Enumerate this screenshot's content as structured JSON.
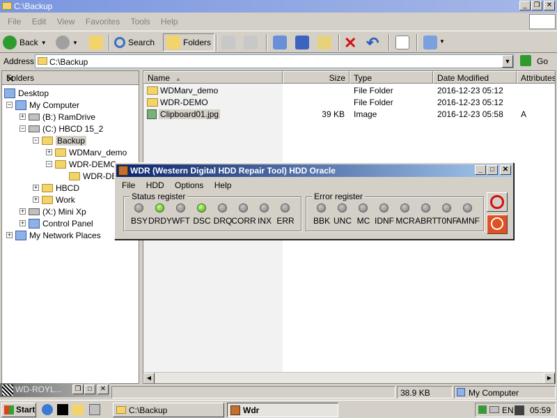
{
  "window": {
    "title": "C:\\Backup"
  },
  "menu": [
    "File",
    "Edit",
    "View",
    "Favorites",
    "Tools",
    "Help"
  ],
  "toolbar": {
    "back": "Back",
    "search": "Search",
    "folders": "Folders"
  },
  "address": {
    "label": "Address",
    "value": "C:\\Backup",
    "go": "Go"
  },
  "folders_pane": {
    "title": "Folders",
    "tree": [
      {
        "label": "Desktop"
      },
      {
        "label": "My Computer"
      },
      {
        "label": "(B:) RamDrive"
      },
      {
        "label": "(C:) HBCD 15_2"
      },
      {
        "label": "Backup"
      },
      {
        "label": "WDMarv_demo"
      },
      {
        "label": "WDR-DEMO"
      },
      {
        "label": "WDR-DE"
      },
      {
        "label": "HBCD"
      },
      {
        "label": "Work"
      },
      {
        "label": "(X:) Mini Xp"
      },
      {
        "label": "Control Panel"
      },
      {
        "label": "My Network Places"
      }
    ]
  },
  "list": {
    "columns": [
      "Name",
      "Size",
      "Type",
      "Date Modified",
      "Attributes"
    ],
    "rows": [
      {
        "name": "WDMarv_demo",
        "size": "",
        "type": "File Folder",
        "date": "2016-12-23 05:12",
        "attr": ""
      },
      {
        "name": "WDR-DEMO",
        "size": "",
        "type": "File Folder",
        "date": "2016-12-23 05:12",
        "attr": ""
      },
      {
        "name": "Clipboard01.jpg",
        "size": "39 KB",
        "type": "Image",
        "date": "2016-12-23 05:58",
        "attr": "A"
      }
    ]
  },
  "statusbar": {
    "size": "38.9 KB",
    "location": "My Computer"
  },
  "mini_window": {
    "title": "WD-ROYL..."
  },
  "wdr": {
    "title": "WDR (Western Digital HDD Repair Tool)   HDD Oracle",
    "menu": [
      "File",
      "HDD",
      "Options",
      "Help"
    ],
    "status_label": "Status register",
    "status": [
      {
        "label": "BSY",
        "on": false
      },
      {
        "label": "DRDY",
        "on": true
      },
      {
        "label": "WFT",
        "on": false
      },
      {
        "label": "DSC",
        "on": true
      },
      {
        "label": "DRQ",
        "on": false
      },
      {
        "label": "CORR",
        "on": false
      },
      {
        "label": "INX",
        "on": false
      },
      {
        "label": "ERR",
        "on": false
      }
    ],
    "error_label": "Error register",
    "errors": [
      {
        "label": "BBK",
        "on": false
      },
      {
        "label": "UNC",
        "on": false
      },
      {
        "label": "MC",
        "on": false
      },
      {
        "label": "IDNF",
        "on": false
      },
      {
        "label": "MCR",
        "on": false
      },
      {
        "label": "ABRT",
        "on": false
      },
      {
        "label": "T0NF",
        "on": false
      },
      {
        "label": "AMNF",
        "on": false
      }
    ]
  },
  "taskbar": {
    "start": "Start",
    "tasks": [
      "C:\\Backup",
      "Wdr"
    ],
    "tray_lang": "EN",
    "clock": "05:59"
  }
}
